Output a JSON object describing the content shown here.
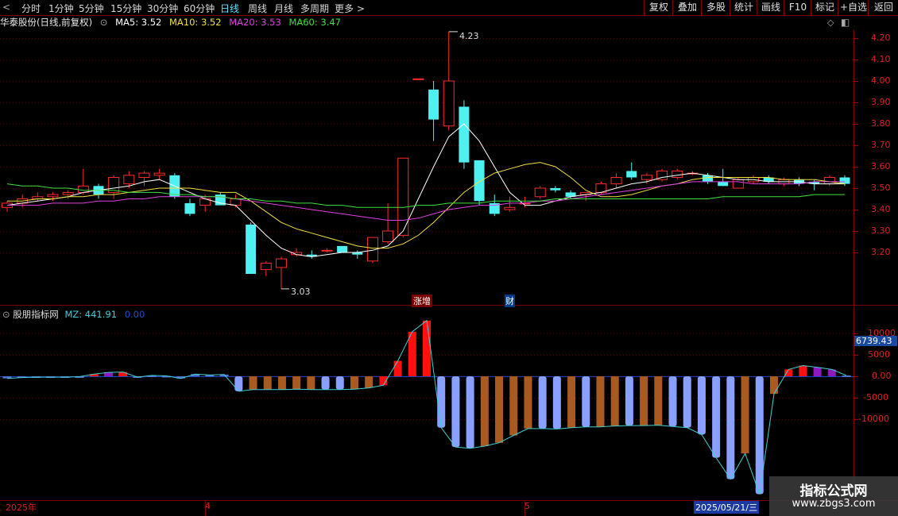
{
  "toolbar": {
    "periods": [
      {
        "label": "分时",
        "active": false
      },
      {
        "label": "1分钟",
        "active": false
      },
      {
        "label": "5分钟",
        "active": false
      },
      {
        "label": "15分钟",
        "active": false
      },
      {
        "label": "30分钟",
        "active": false
      },
      {
        "label": "60分钟",
        "active": false
      },
      {
        "label": "日线",
        "active": true
      },
      {
        "label": "周线",
        "active": false
      },
      {
        "label": "月线",
        "active": false
      },
      {
        "label": "多周期",
        "active": false
      },
      {
        "label": "更多 >",
        "active": false
      }
    ],
    "right_buttons": [
      "复权",
      "叠加",
      "多股",
      "统计",
      "画线",
      "F10",
      "标记",
      "+自选",
      "返回"
    ]
  },
  "stock": {
    "title": "华泰股份(日线,前复权)",
    "ma5_label": "MA5: 3.52",
    "ma10_label": "MA10: 3.52",
    "ma20_label": "MA20: 3.53",
    "ma60_label": "MA60: 3.47"
  },
  "price_axis": [
    "4.20",
    "4.10",
    "4.00",
    "3.90",
    "3.80",
    "3.70",
    "3.60",
    "3.50",
    "3.40",
    "3.30",
    "3.20"
  ],
  "price_marks": {
    "high": "4.23",
    "low": "3.03"
  },
  "event_tags": {
    "zhang": "涨增",
    "cai": "财"
  },
  "indicator": {
    "title": "股朋指标网",
    "mz_label": "MZ: 441.91",
    "zero_label": "0.00",
    "current_value": "6739.43",
    "axis": [
      "10000",
      "5000",
      "0.00",
      "-5000",
      "-10000"
    ]
  },
  "date_axis": {
    "year": "2025年",
    "m4": "4",
    "m5": "5",
    "cursor_date": "2025/05/21/三"
  },
  "watermark": {
    "title": "指标公式网",
    "url": "www.zbgs3.com"
  },
  "colors": {
    "up": "#ff2a2a",
    "down": "#4ff0f0",
    "ma5": "#ffffff",
    "ma10": "#f0e040",
    "ma20": "#e040e0",
    "ma60": "#40e040",
    "grid": "#5a0000"
  },
  "chart_data": [
    {
      "type": "candlestick",
      "title": "华泰股份(日线,前复权)",
      "ylim": [
        3.0,
        4.25
      ],
      "candles": [
        {
          "o": 3.41,
          "h": 3.44,
          "l": 3.39,
          "c": 3.43
        },
        {
          "o": 3.43,
          "h": 3.47,
          "l": 3.41,
          "c": 3.45
        },
        {
          "o": 3.45,
          "h": 3.48,
          "l": 3.44,
          "c": 3.46
        },
        {
          "o": 3.46,
          "h": 3.48,
          "l": 3.44,
          "c": 3.47
        },
        {
          "o": 3.47,
          "h": 3.49,
          "l": 3.45,
          "c": 3.48
        },
        {
          "o": 3.48,
          "h": 3.59,
          "l": 3.47,
          "c": 3.51
        },
        {
          "o": 3.51,
          "h": 3.52,
          "l": 3.45,
          "c": 3.47
        },
        {
          "o": 3.48,
          "h": 3.56,
          "l": 3.45,
          "c": 3.55
        },
        {
          "o": 3.52,
          "h": 3.58,
          "l": 3.5,
          "c": 3.56
        },
        {
          "o": 3.55,
          "h": 3.58,
          "l": 3.51,
          "c": 3.57
        },
        {
          "o": 3.56,
          "h": 3.59,
          "l": 3.54,
          "c": 3.57
        },
        {
          "o": 3.56,
          "h": 3.57,
          "l": 3.45,
          "c": 3.46
        },
        {
          "o": 3.43,
          "h": 3.45,
          "l": 3.37,
          "c": 3.38
        },
        {
          "o": 3.42,
          "h": 3.47,
          "l": 3.39,
          "c": 3.45
        },
        {
          "o": 3.47,
          "h": 3.48,
          "l": 3.42,
          "c": 3.42
        },
        {
          "o": 3.42,
          "h": 3.47,
          "l": 3.41,
          "c": 3.45
        },
        {
          "o": 3.33,
          "h": 3.34,
          "l": 3.1,
          "c": 3.1
        },
        {
          "o": 3.12,
          "h": 3.16,
          "l": 3.09,
          "c": 3.15
        },
        {
          "o": 3.13,
          "h": 3.18,
          "l": 3.03,
          "c": 3.17
        },
        {
          "o": 3.19,
          "h": 3.22,
          "l": 3.18,
          "c": 3.2
        },
        {
          "o": 3.19,
          "h": 3.21,
          "l": 3.17,
          "c": 3.18
        },
        {
          "o": 3.21,
          "h": 3.22,
          "l": 3.2,
          "c": 3.21
        },
        {
          "o": 3.23,
          "h": 3.23,
          "l": 3.2,
          "c": 3.2
        },
        {
          "o": 3.2,
          "h": 3.21,
          "l": 3.17,
          "c": 3.19
        },
        {
          "o": 3.16,
          "h": 3.24,
          "l": 3.15,
          "c": 3.27
        },
        {
          "o": 3.25,
          "h": 3.43,
          "l": 3.24,
          "c": 3.3
        },
        {
          "o": 3.28,
          "h": 3.64,
          "l": 3.27,
          "c": 3.64
        },
        {
          "o": 4.01,
          "h": 4.01,
          "l": 4.01,
          "c": 4.01
        },
        {
          "o": 3.96,
          "h": 4.0,
          "l": 3.72,
          "c": 3.82
        },
        {
          "o": 3.79,
          "h": 4.23,
          "l": 3.77,
          "c": 4.0
        },
        {
          "o": 3.88,
          "h": 3.91,
          "l": 3.59,
          "c": 3.62
        },
        {
          "o": 3.63,
          "h": 3.63,
          "l": 3.42,
          "c": 3.44
        },
        {
          "o": 3.43,
          "h": 3.47,
          "l": 3.37,
          "c": 3.38
        },
        {
          "o": 3.4,
          "h": 3.46,
          "l": 3.39,
          "c": 3.41
        },
        {
          "o": 3.43,
          "h": 3.46,
          "l": 3.41,
          "c": 3.43
        },
        {
          "o": 3.46,
          "h": 3.51,
          "l": 3.45,
          "c": 3.5
        },
        {
          "o": 3.5,
          "h": 3.51,
          "l": 3.48,
          "c": 3.49
        },
        {
          "o": 3.48,
          "h": 3.49,
          "l": 3.45,
          "c": 3.46
        },
        {
          "o": 3.47,
          "h": 3.48,
          "l": 3.44,
          "c": 3.48
        },
        {
          "o": 3.48,
          "h": 3.53,
          "l": 3.47,
          "c": 3.52
        },
        {
          "o": 3.52,
          "h": 3.57,
          "l": 3.5,
          "c": 3.55
        },
        {
          "o": 3.58,
          "h": 3.62,
          "l": 3.54,
          "c": 3.55
        },
        {
          "o": 3.54,
          "h": 3.57,
          "l": 3.52,
          "c": 3.56
        },
        {
          "o": 3.54,
          "h": 3.59,
          "l": 3.53,
          "c": 3.58
        },
        {
          "o": 3.55,
          "h": 3.59,
          "l": 3.54,
          "c": 3.58
        },
        {
          "o": 3.57,
          "h": 3.58,
          "l": 3.56,
          "c": 3.57
        },
        {
          "o": 3.56,
          "h": 3.57,
          "l": 3.52,
          "c": 3.53
        },
        {
          "o": 3.53,
          "h": 3.59,
          "l": 3.51,
          "c": 3.51
        },
        {
          "o": 3.5,
          "h": 3.55,
          "l": 3.5,
          "c": 3.54
        },
        {
          "o": 3.53,
          "h": 3.56,
          "l": 3.52,
          "c": 3.55
        },
        {
          "o": 3.55,
          "h": 3.56,
          "l": 3.52,
          "c": 3.53
        },
        {
          "o": 3.52,
          "h": 3.55,
          "l": 3.51,
          "c": 3.54
        },
        {
          "o": 3.54,
          "h": 3.55,
          "l": 3.51,
          "c": 3.52
        },
        {
          "o": 3.53,
          "h": 3.54,
          "l": 3.49,
          "c": 3.52
        },
        {
          "o": 3.52,
          "h": 3.56,
          "l": 3.51,
          "c": 3.55
        },
        {
          "o": 3.55,
          "h": 3.56,
          "l": 3.51,
          "c": 3.52
        }
      ],
      "ma": {
        "ma5": [
          3.42,
          3.43,
          3.44,
          3.45,
          3.46,
          3.48,
          3.49,
          3.5,
          3.51,
          3.53,
          3.54,
          3.51,
          3.48,
          3.45,
          3.43,
          3.42,
          3.35,
          3.28,
          3.22,
          3.19,
          3.18,
          3.19,
          3.2,
          3.2,
          3.21,
          3.23,
          3.3,
          3.45,
          3.6,
          3.74,
          3.8,
          3.72,
          3.6,
          3.48,
          3.42,
          3.42,
          3.44,
          3.46,
          3.47,
          3.48,
          3.5,
          3.52,
          3.53,
          3.55,
          3.56,
          3.57,
          3.56,
          3.55,
          3.54,
          3.54,
          3.53,
          3.53,
          3.53,
          3.52,
          3.52,
          3.52
        ],
        "ma10": [
          3.44,
          3.44,
          3.45,
          3.45,
          3.46,
          3.46,
          3.47,
          3.47,
          3.48,
          3.49,
          3.5,
          3.5,
          3.5,
          3.49,
          3.48,
          3.48,
          3.44,
          3.39,
          3.34,
          3.31,
          3.29,
          3.27,
          3.25,
          3.23,
          3.22,
          3.22,
          3.24,
          3.28,
          3.34,
          3.41,
          3.48,
          3.53,
          3.57,
          3.59,
          3.61,
          3.62,
          3.6,
          3.55,
          3.49,
          3.46,
          3.46,
          3.47,
          3.49,
          3.51,
          3.52,
          3.54,
          3.55,
          3.55,
          3.55,
          3.55,
          3.55,
          3.54,
          3.54,
          3.54,
          3.53,
          3.52
        ],
        "ma20": [
          3.42,
          3.42,
          3.42,
          3.43,
          3.43,
          3.43,
          3.44,
          3.44,
          3.45,
          3.45,
          3.46,
          3.46,
          3.46,
          3.46,
          3.46,
          3.45,
          3.44,
          3.43,
          3.42,
          3.41,
          3.4,
          3.39,
          3.38,
          3.37,
          3.36,
          3.35,
          3.35,
          3.36,
          3.38,
          3.4,
          3.41,
          3.42,
          3.42,
          3.43,
          3.43,
          3.44,
          3.44,
          3.45,
          3.46,
          3.47,
          3.48,
          3.49,
          3.5,
          3.51,
          3.52,
          3.53,
          3.53,
          3.53,
          3.53,
          3.52,
          3.52,
          3.52,
          3.52,
          3.53,
          3.53,
          3.53
        ],
        "ma60": [
          3.52,
          3.51,
          3.51,
          3.5,
          3.5,
          3.49,
          3.49,
          3.49,
          3.48,
          3.48,
          3.48,
          3.47,
          3.47,
          3.46,
          3.46,
          3.45,
          3.45,
          3.44,
          3.44,
          3.43,
          3.43,
          3.42,
          3.42,
          3.41,
          3.41,
          3.41,
          3.41,
          3.42,
          3.42,
          3.43,
          3.43,
          3.43,
          3.44,
          3.44,
          3.44,
          3.44,
          3.45,
          3.45,
          3.45,
          3.45,
          3.45,
          3.45,
          3.45,
          3.45,
          3.45,
          3.45,
          3.45,
          3.46,
          3.46,
          3.46,
          3.46,
          3.46,
          3.46,
          3.47,
          3.47,
          3.47
        ]
      }
    },
    {
      "type": "bar",
      "title": "股朋指标网",
      "ylim": [
        -17000,
        13000
      ],
      "values": [
        -500,
        -300,
        -200,
        -200,
        -200,
        -100,
        500,
        900,
        1000,
        -200,
        200,
        100,
        -500,
        500,
        300,
        400,
        -3500,
        -3100,
        -3100,
        -3100,
        -3000,
        -3100,
        -3100,
        -3100,
        -3000,
        -2700,
        -2100,
        3600,
        10400,
        13000,
        -12000,
        -16500,
        -16800,
        -16300,
        -15500,
        -13800,
        -12200,
        -12200,
        -12300,
        -12000,
        -11800,
        -11800,
        -11600,
        -11500,
        -11500,
        -11400,
        -11700,
        -12000,
        -13600,
        -19000,
        -24000,
        -18000,
        -27500,
        -4100,
        1600,
        2500,
        2100,
        1600,
        200
      ],
      "colors": [
        "s",
        "s",
        "s",
        "s",
        "s",
        "s",
        "r",
        "p",
        "r",
        "s",
        "s",
        "s",
        "s",
        "s",
        "s",
        "s",
        "b",
        "o",
        "o",
        "o",
        "o",
        "o",
        "b",
        "b",
        "o",
        "o",
        "r",
        "r",
        "r",
        "r",
        "b",
        "b",
        "b",
        "o",
        "o",
        "o",
        "o",
        "b",
        "b",
        "o",
        "b",
        "o",
        "o",
        "b",
        "o",
        "o",
        "b",
        "b",
        "b",
        "b",
        "b",
        "o",
        "b",
        "o",
        "r",
        "r",
        "p",
        "p",
        "s"
      ]
    }
  ]
}
